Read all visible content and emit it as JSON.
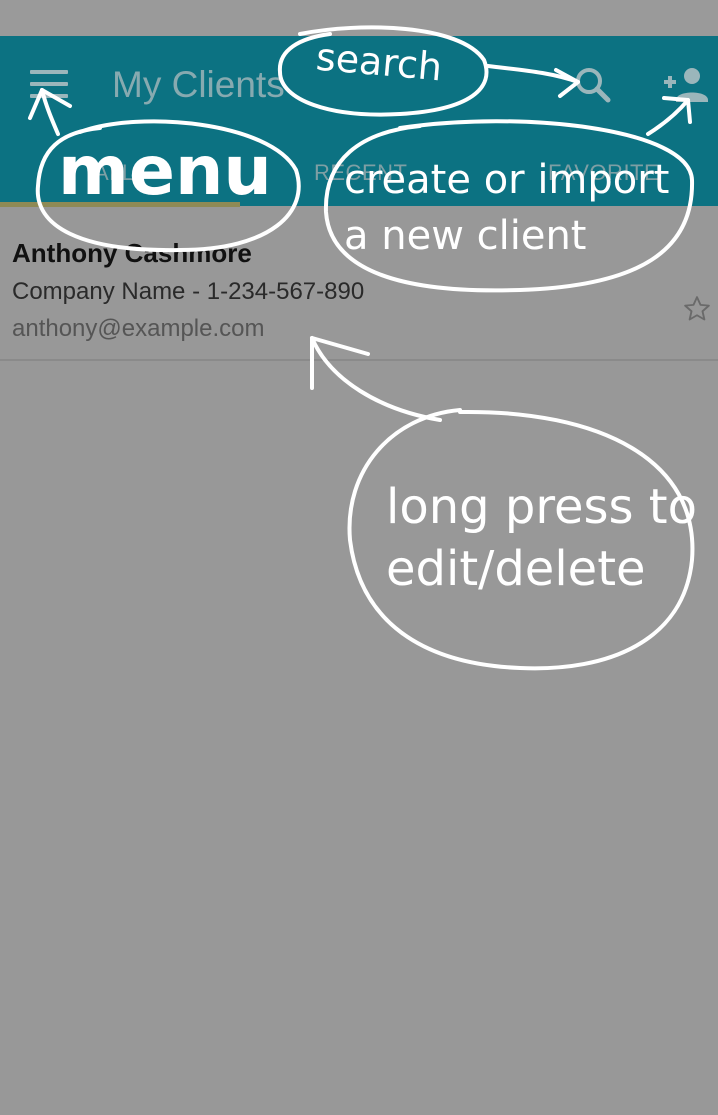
{
  "app_bar": {
    "title": "My Clients",
    "menu_icon": "hamburger-menu-icon",
    "search_icon": "search-icon",
    "add_icon": "add-person-icon",
    "background_color": "#0c7282"
  },
  "tabs": [
    {
      "label": "ALL",
      "selected": true
    },
    {
      "label": "RECENT",
      "selected": false
    },
    {
      "label": "FAVORITE",
      "selected": false
    }
  ],
  "clients": [
    {
      "name": "Anthony Cashmore",
      "company_line": "Company Name - 1-234-567-890",
      "email": "anthony@example.com",
      "favorite": false,
      "star_icon": "star-outline-icon"
    }
  ],
  "annotations": {
    "search": "search",
    "menu": "menu",
    "create": "create or import a new client",
    "long_press": "long press to edit/delete"
  }
}
